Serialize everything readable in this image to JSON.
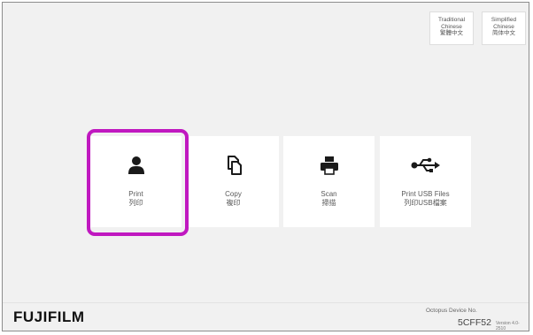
{
  "language_buttons": {
    "traditional": {
      "line1": "Traditional",
      "line2": "Chinese",
      "line3": "繁體中文"
    },
    "simplified": {
      "line1": "Simplified",
      "line2": "Chinese",
      "line3": "简体中文"
    }
  },
  "tiles": {
    "print": {
      "label_en": "Print",
      "label_zh": "列印",
      "icon": "person-icon"
    },
    "copy": {
      "label_en": "Copy",
      "label_zh": "複印",
      "icon": "copy-icon"
    },
    "scan": {
      "label_en": "Scan",
      "label_zh": "掃描",
      "icon": "printer-icon"
    },
    "usb": {
      "label_en": "Print USB Files",
      "label_zh": "列印USB檔案",
      "icon": "usb-icon"
    }
  },
  "highlight_color": "#c018c0",
  "footer": {
    "brand": "FUJIFILM",
    "device_label": "Octopus Device No.",
    "device_no": "5CFF52",
    "version": "Version 4.0-2510"
  }
}
